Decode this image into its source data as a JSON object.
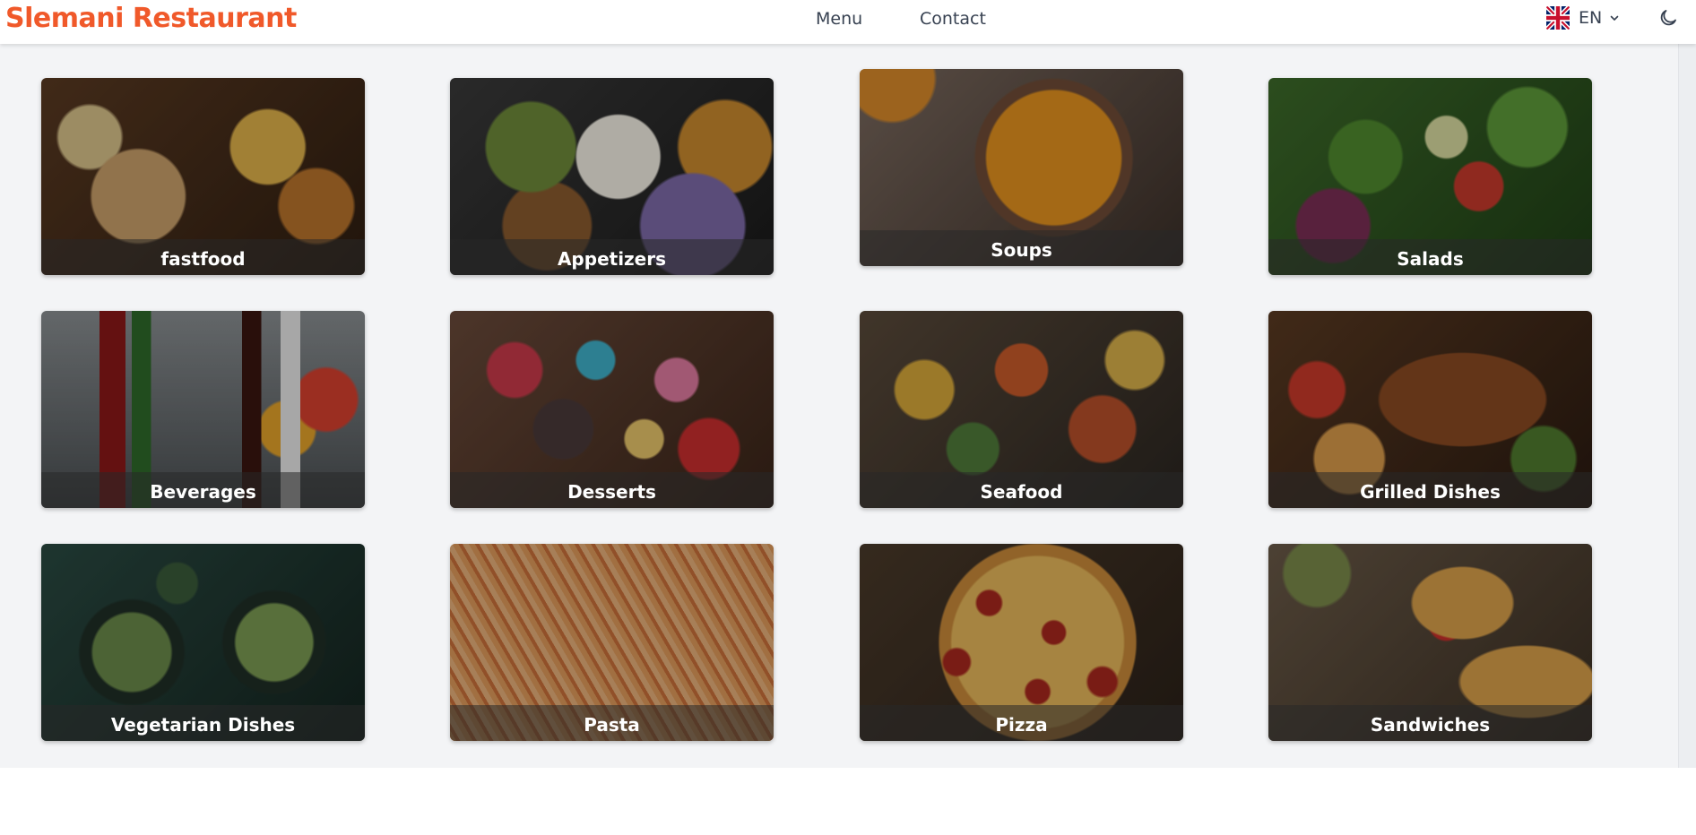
{
  "navbar": {
    "brand": "Slemani Restaurant",
    "links": [
      "Menu",
      "Contact"
    ],
    "language": {
      "code": "EN",
      "flag_icon": "uk-flag-icon"
    },
    "theme_icon": "moon-icon"
  },
  "colors": {
    "brand": "#f0592a",
    "background": "#f3f4f6",
    "label_text": "#ffffff"
  },
  "categories": [
    {
      "label": "fastfood",
      "photo": "fastfood"
    },
    {
      "label": "Appetizers",
      "photo": "appetizers"
    },
    {
      "label": "Soups",
      "photo": "soups"
    },
    {
      "label": "Salads",
      "photo": "salads"
    },
    {
      "label": "Beverages",
      "photo": "beverages"
    },
    {
      "label": "Desserts",
      "photo": "desserts"
    },
    {
      "label": "Seafood",
      "photo": "seafood"
    },
    {
      "label": "Grilled Dishes",
      "photo": "grilled"
    },
    {
      "label": "Vegetarian Dishes",
      "photo": "vegetarian"
    },
    {
      "label": "Pasta",
      "photo": "pasta"
    },
    {
      "label": "Pizza",
      "photo": "pizza"
    },
    {
      "label": "Sandwiches",
      "photo": "sandwiches"
    }
  ]
}
